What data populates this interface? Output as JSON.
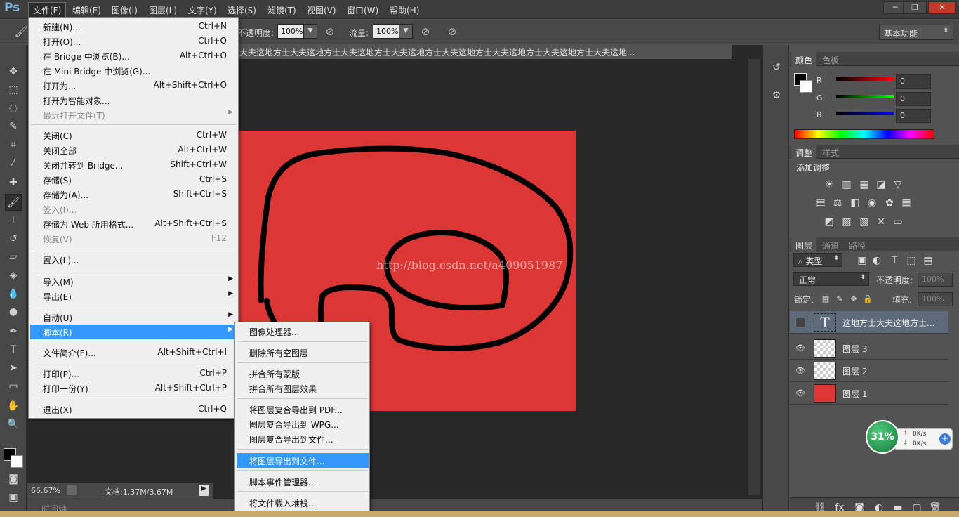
{
  "app": {
    "logo": "Ps"
  },
  "menubar": {
    "items": [
      "文件(F)",
      "编辑(E)",
      "图像(I)",
      "图层(L)",
      "文字(Y)",
      "选择(S)",
      "滤镜(T)",
      "视图(V)",
      "窗口(W)",
      "帮助(H)"
    ],
    "open": "文件(F)"
  },
  "window_controls": {
    "minimize": "─",
    "restore": "❐",
    "close": "✕"
  },
  "options": {
    "opacity_label": "不透明度:",
    "opacity_value": "100%",
    "flow_label": "流量:",
    "flow_value": "100%",
    "workspace": "基本功能"
  },
  "document": {
    "tab_title": "大夫这地方士大夫这地方士大夫这地方士大夫这地方士大夫这地方士大夫这地方士大夫这地方士大夫这地...",
    "watermark": "http://blog.csdn.net/a409051987",
    "zoom": "66.67%",
    "doc_info": "文档:1.37M/3.67M",
    "timeline_label": "时间轴",
    "canvas_color": "#dc3735"
  },
  "file_menu": {
    "items": [
      {
        "label": "新建(N)...",
        "shortcut": "Ctrl+N"
      },
      {
        "label": "打开(O)...",
        "shortcut": "Ctrl+O"
      },
      {
        "label": "在 Bridge 中浏览(B)...",
        "shortcut": "Alt+Ctrl+O"
      },
      {
        "label": "在 Mini Bridge 中浏览(G)...",
        "shortcut": ""
      },
      {
        "label": "打开为...",
        "shortcut": "Alt+Shift+Ctrl+O"
      },
      {
        "label": "打开为智能对象...",
        "shortcut": ""
      },
      {
        "label": "最近打开文件(T)",
        "shortcut": "",
        "disabled": true,
        "submenu": true
      },
      {
        "label": "关闭(C)",
        "shortcut": "Ctrl+W"
      },
      {
        "label": "关闭全部",
        "shortcut": "Alt+Ctrl+W"
      },
      {
        "label": "关闭并转到 Bridge...",
        "shortcut": "Shift+Ctrl+W"
      },
      {
        "label": "存储(S)",
        "shortcut": "Ctrl+S"
      },
      {
        "label": "存储为(A)...",
        "shortcut": "Shift+Ctrl+S"
      },
      {
        "label": "签入(I)...",
        "shortcut": "",
        "disabled": true
      },
      {
        "label": "存储为 Web 所用格式...",
        "shortcut": "Alt+Shift+Ctrl+S"
      },
      {
        "label": "恢复(V)",
        "shortcut": "F12",
        "disabled": true
      },
      {
        "label": "置入(L)...",
        "shortcut": ""
      },
      {
        "label": "导入(M)",
        "shortcut": "",
        "submenu": true
      },
      {
        "label": "导出(E)",
        "shortcut": "",
        "submenu": true
      },
      {
        "label": "自动(U)",
        "shortcut": "",
        "submenu": true
      },
      {
        "label": "脚本(R)",
        "shortcut": "",
        "submenu": true,
        "highlighted": true
      },
      {
        "label": "文件简介(F)...",
        "shortcut": "Alt+Shift+Ctrl+I"
      },
      {
        "label": "打印(P)...",
        "shortcut": "Ctrl+P"
      },
      {
        "label": "打印一份(Y)",
        "shortcut": "Alt+Shift+Ctrl+P"
      },
      {
        "label": "退出(X)",
        "shortcut": "Ctrl+Q"
      }
    ]
  },
  "script_submenu": {
    "items": [
      {
        "label": "图像处理器..."
      },
      {
        "label": "删除所有空图层"
      },
      {
        "label": "拼合所有蒙版"
      },
      {
        "label": "拼合所有图层效果"
      },
      {
        "label": "将图层复合导出到 PDF..."
      },
      {
        "label": "图层复合导出到 WPG..."
      },
      {
        "label": "图层复合导出到文件..."
      },
      {
        "label": "将图层导出到文件...",
        "highlighted": true
      },
      {
        "label": "脚本事件管理器..."
      },
      {
        "label": "将文件载入堆栈..."
      }
    ]
  },
  "color_panel": {
    "tabs": [
      "颜色",
      "色板"
    ],
    "r_label": "R",
    "g_label": "G",
    "b_label": "B",
    "r_value": "0",
    "g_value": "0",
    "b_value": "0"
  },
  "adjust_panel": {
    "tabs": [
      "调整",
      "样式"
    ],
    "title": "添加调整"
  },
  "layers_panel": {
    "tabs": [
      "图层",
      "通道",
      "路径"
    ],
    "filter": "类型",
    "blend_mode": "正常",
    "opacity_label": "不透明度:",
    "opacity_value": "100%",
    "lock_label": "锁定:",
    "fill_label": "填充:",
    "fill_value": "100%",
    "layers": [
      {
        "name": "这地方士大夫这地方士...",
        "type": "text",
        "visible": false,
        "selected": true
      },
      {
        "name": "图层 3",
        "type": "pixel",
        "visible": true
      },
      {
        "name": "图层 2",
        "type": "pixel",
        "visible": true
      },
      {
        "name": "图层 1",
        "type": "fill",
        "visible": true
      }
    ]
  },
  "net_widget": {
    "percent": "31%",
    "up": "0K/s",
    "down": "0K/s"
  }
}
